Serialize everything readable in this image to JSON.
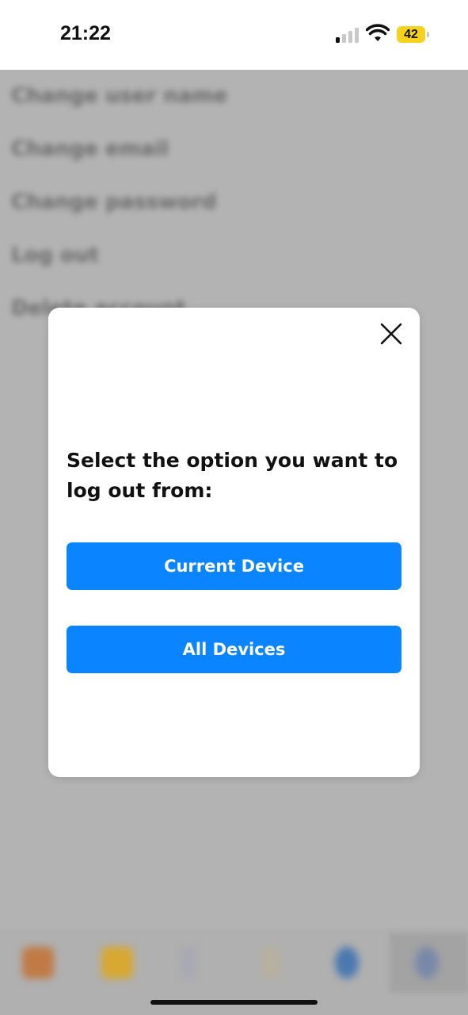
{
  "status_bar": {
    "time": "21:22",
    "battery_level": "42",
    "signal_bars_active": 1,
    "signal_bars_total": 4,
    "icons": [
      "signal-icon",
      "wifi-icon",
      "battery-icon"
    ]
  },
  "background": {
    "settings_items": [
      {
        "label": "Change user name"
      },
      {
        "label": "Change email"
      },
      {
        "label": "Change password"
      },
      {
        "label": "Log out"
      },
      {
        "label": "Delete account"
      }
    ],
    "tab_icons": [
      "home-icon",
      "folder-icon",
      "tab-icon-3",
      "tab-icon-4",
      "globe-icon",
      "settings-icon"
    ]
  },
  "modal": {
    "title": "Select the option you want to log out from:",
    "close_icon": "close-icon",
    "buttons": {
      "current_device": "Current Device",
      "all_devices": "All Devices"
    }
  },
  "colors": {
    "accent": "#0a84ff",
    "overlay": "#b3b3b3",
    "battery": "#f6d21d"
  }
}
